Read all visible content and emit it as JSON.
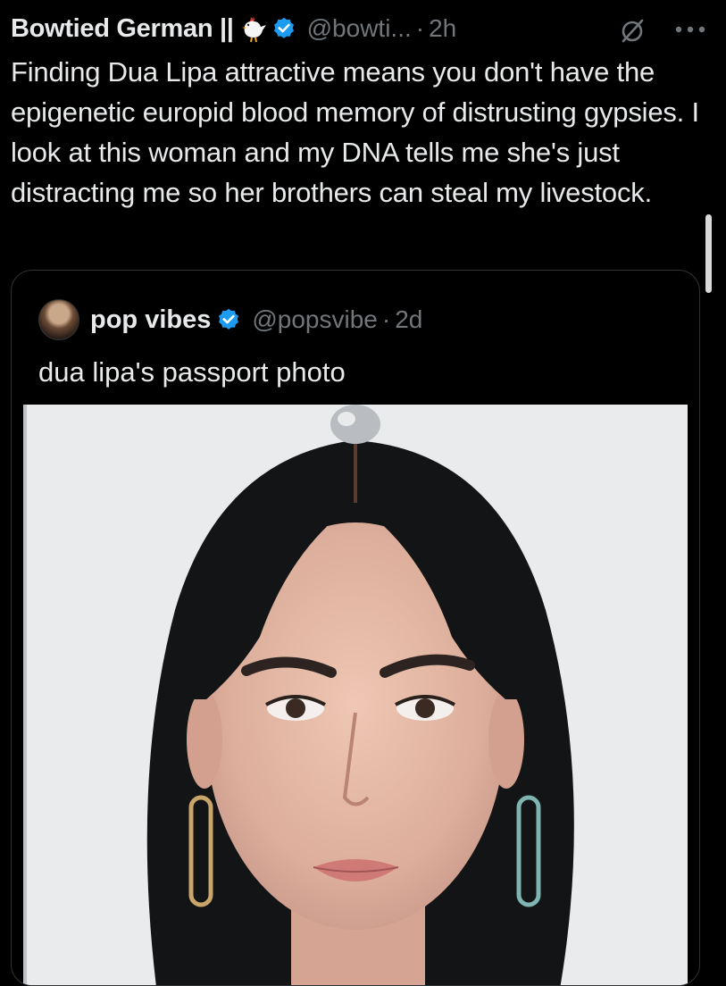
{
  "tweet": {
    "author_name": "Bowtied German ||",
    "handle": "@bowti...",
    "separator": "·",
    "time": "2h",
    "text": "Finding Dua Lipa attractive means you don't have the epigenetic europid blood memory of distrusting gypsies.  I look at this woman and my DNA tells me she's just distracting me so her brothers can steal my livestock.",
    "icons": [
      "rooster-emoji-icon",
      "verified-badge-icon",
      "grok-icon",
      "more-options-icon"
    ]
  },
  "quoted_tweet": {
    "author_name": "pop vibes",
    "handle": "@popsvibe",
    "separator": "·",
    "time": "2d",
    "text": "dua lipa's passport photo",
    "icons": [
      "avatar",
      "verified-badge-icon"
    ]
  },
  "colors": {
    "background": "#000000",
    "text_primary": "#e7e9ea",
    "text_secondary": "#71767b",
    "verified_blue": "#1d9bf0",
    "border": "#2f3336"
  }
}
